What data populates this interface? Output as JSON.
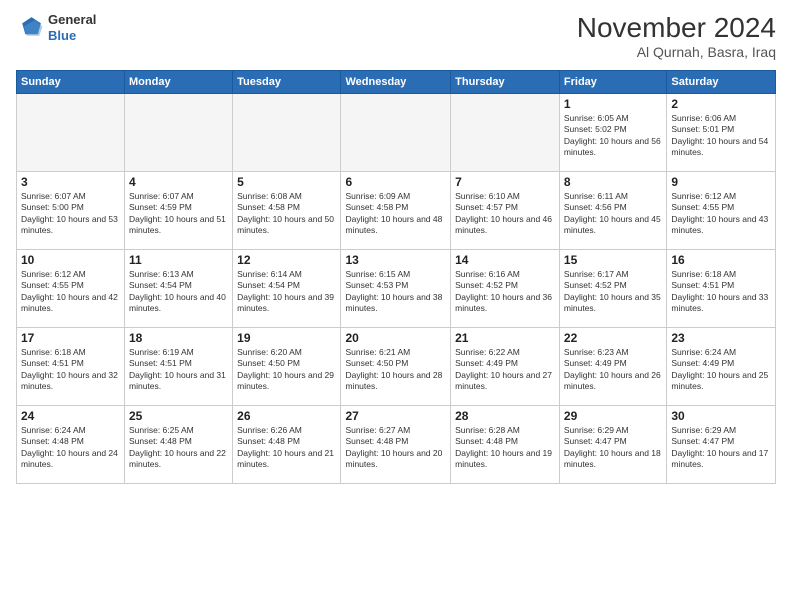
{
  "header": {
    "logo_line1": "General",
    "logo_line2": "Blue",
    "month_title": "November 2024",
    "location": "Al Qurnah, Basra, Iraq"
  },
  "days_of_week": [
    "Sunday",
    "Monday",
    "Tuesday",
    "Wednesday",
    "Thursday",
    "Friday",
    "Saturday"
  ],
  "weeks": [
    [
      {
        "day": "",
        "info": ""
      },
      {
        "day": "",
        "info": ""
      },
      {
        "day": "",
        "info": ""
      },
      {
        "day": "",
        "info": ""
      },
      {
        "day": "",
        "info": ""
      },
      {
        "day": "1",
        "info": "Sunrise: 6:05 AM\nSunset: 5:02 PM\nDaylight: 10 hours and 56 minutes."
      },
      {
        "day": "2",
        "info": "Sunrise: 6:06 AM\nSunset: 5:01 PM\nDaylight: 10 hours and 54 minutes."
      }
    ],
    [
      {
        "day": "3",
        "info": "Sunrise: 6:07 AM\nSunset: 5:00 PM\nDaylight: 10 hours and 53 minutes."
      },
      {
        "day": "4",
        "info": "Sunrise: 6:07 AM\nSunset: 4:59 PM\nDaylight: 10 hours and 51 minutes."
      },
      {
        "day": "5",
        "info": "Sunrise: 6:08 AM\nSunset: 4:58 PM\nDaylight: 10 hours and 50 minutes."
      },
      {
        "day": "6",
        "info": "Sunrise: 6:09 AM\nSunset: 4:58 PM\nDaylight: 10 hours and 48 minutes."
      },
      {
        "day": "7",
        "info": "Sunrise: 6:10 AM\nSunset: 4:57 PM\nDaylight: 10 hours and 46 minutes."
      },
      {
        "day": "8",
        "info": "Sunrise: 6:11 AM\nSunset: 4:56 PM\nDaylight: 10 hours and 45 minutes."
      },
      {
        "day": "9",
        "info": "Sunrise: 6:12 AM\nSunset: 4:55 PM\nDaylight: 10 hours and 43 minutes."
      }
    ],
    [
      {
        "day": "10",
        "info": "Sunrise: 6:12 AM\nSunset: 4:55 PM\nDaylight: 10 hours and 42 minutes."
      },
      {
        "day": "11",
        "info": "Sunrise: 6:13 AM\nSunset: 4:54 PM\nDaylight: 10 hours and 40 minutes."
      },
      {
        "day": "12",
        "info": "Sunrise: 6:14 AM\nSunset: 4:54 PM\nDaylight: 10 hours and 39 minutes."
      },
      {
        "day": "13",
        "info": "Sunrise: 6:15 AM\nSunset: 4:53 PM\nDaylight: 10 hours and 38 minutes."
      },
      {
        "day": "14",
        "info": "Sunrise: 6:16 AM\nSunset: 4:52 PM\nDaylight: 10 hours and 36 minutes."
      },
      {
        "day": "15",
        "info": "Sunrise: 6:17 AM\nSunset: 4:52 PM\nDaylight: 10 hours and 35 minutes."
      },
      {
        "day": "16",
        "info": "Sunrise: 6:18 AM\nSunset: 4:51 PM\nDaylight: 10 hours and 33 minutes."
      }
    ],
    [
      {
        "day": "17",
        "info": "Sunrise: 6:18 AM\nSunset: 4:51 PM\nDaylight: 10 hours and 32 minutes."
      },
      {
        "day": "18",
        "info": "Sunrise: 6:19 AM\nSunset: 4:51 PM\nDaylight: 10 hours and 31 minutes."
      },
      {
        "day": "19",
        "info": "Sunrise: 6:20 AM\nSunset: 4:50 PM\nDaylight: 10 hours and 29 minutes."
      },
      {
        "day": "20",
        "info": "Sunrise: 6:21 AM\nSunset: 4:50 PM\nDaylight: 10 hours and 28 minutes."
      },
      {
        "day": "21",
        "info": "Sunrise: 6:22 AM\nSunset: 4:49 PM\nDaylight: 10 hours and 27 minutes."
      },
      {
        "day": "22",
        "info": "Sunrise: 6:23 AM\nSunset: 4:49 PM\nDaylight: 10 hours and 26 minutes."
      },
      {
        "day": "23",
        "info": "Sunrise: 6:24 AM\nSunset: 4:49 PM\nDaylight: 10 hours and 25 minutes."
      }
    ],
    [
      {
        "day": "24",
        "info": "Sunrise: 6:24 AM\nSunset: 4:48 PM\nDaylight: 10 hours and 24 minutes."
      },
      {
        "day": "25",
        "info": "Sunrise: 6:25 AM\nSunset: 4:48 PM\nDaylight: 10 hours and 22 minutes."
      },
      {
        "day": "26",
        "info": "Sunrise: 6:26 AM\nSunset: 4:48 PM\nDaylight: 10 hours and 21 minutes."
      },
      {
        "day": "27",
        "info": "Sunrise: 6:27 AM\nSunset: 4:48 PM\nDaylight: 10 hours and 20 minutes."
      },
      {
        "day": "28",
        "info": "Sunrise: 6:28 AM\nSunset: 4:48 PM\nDaylight: 10 hours and 19 minutes."
      },
      {
        "day": "29",
        "info": "Sunrise: 6:29 AM\nSunset: 4:47 PM\nDaylight: 10 hours and 18 minutes."
      },
      {
        "day": "30",
        "info": "Sunrise: 6:29 AM\nSunset: 4:47 PM\nDaylight: 10 hours and 17 minutes."
      }
    ]
  ]
}
